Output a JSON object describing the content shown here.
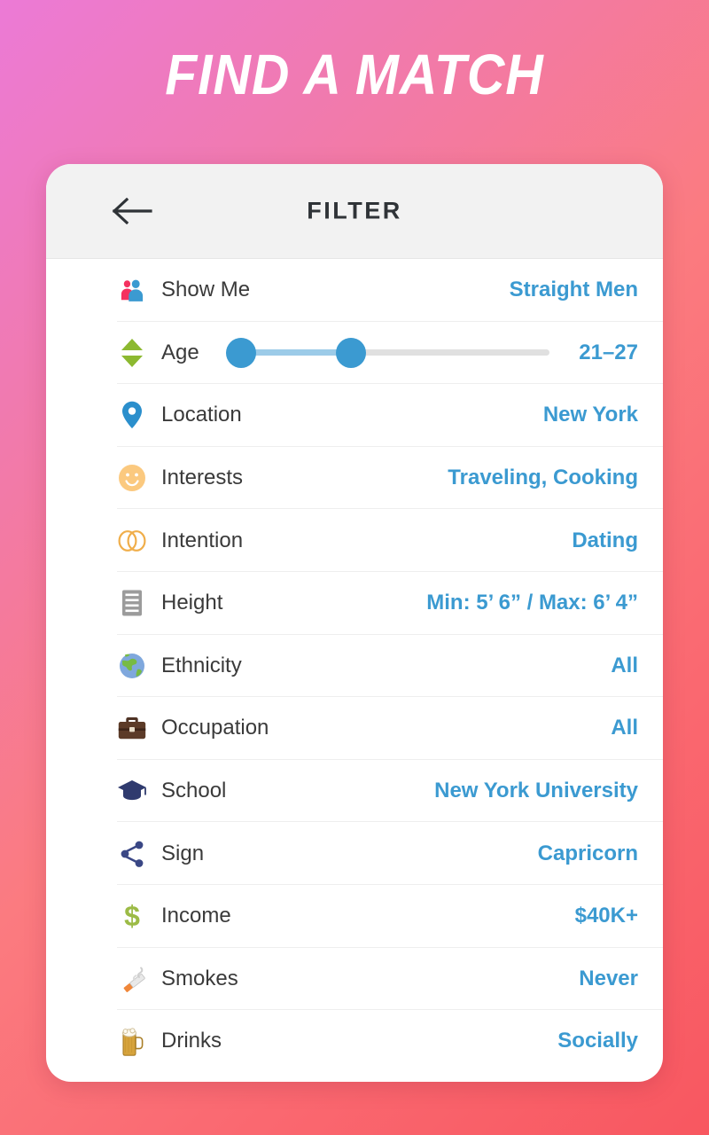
{
  "hero": {
    "title": "FIND A MATCH"
  },
  "header": {
    "title": "FILTER",
    "back_icon": "arrow-left-icon"
  },
  "theme": {
    "value_blue": "#3b9ad1",
    "label_dark": "#3a3a3a",
    "header_bg": "#f2f2f2",
    "bg_gradient_start": "#ec7ad6",
    "bg_gradient_end": "#f85760",
    "divider": "#eeeeee"
  },
  "age_slider": {
    "min_value": 21,
    "max_value": 27,
    "range_label": "21–27",
    "track_min": 18,
    "track_max": 60
  },
  "rows": [
    {
      "label": "Show Me",
      "value": "Straight Men",
      "icon": "two-people-icon"
    },
    {
      "label": "Age",
      "value": "21–27",
      "icon": "up-down-arrows-icon"
    },
    {
      "label": "Location",
      "value": "New York",
      "icon": "map-pin-icon"
    },
    {
      "label": "Interests",
      "value": "Traveling, Cooking",
      "icon": "smiley-face-icon"
    },
    {
      "label": "Intention",
      "value": "Dating",
      "icon": "wedding-rings-icon"
    },
    {
      "label": "Height",
      "value": "Min: 5’ 6” / Max: 6’ 4”",
      "icon": "ruler-list-icon"
    },
    {
      "label": "Ethnicity",
      "value": "All",
      "icon": "globe-icon"
    },
    {
      "label": "Occupation",
      "value": "All",
      "icon": "briefcase-icon"
    },
    {
      "label": "School",
      "value": "New York University",
      "icon": "graduation-cap-icon"
    },
    {
      "label": "Sign",
      "value": "Capricorn",
      "icon": "share-nodes-icon"
    },
    {
      "label": "Income",
      "value": "$40K+",
      "icon": "dollar-sign-icon"
    },
    {
      "label": "Smokes",
      "value": "Never",
      "icon": "cigarette-icon"
    },
    {
      "label": "Drinks",
      "value": "Socially",
      "icon": "beer-mug-icon"
    }
  ]
}
